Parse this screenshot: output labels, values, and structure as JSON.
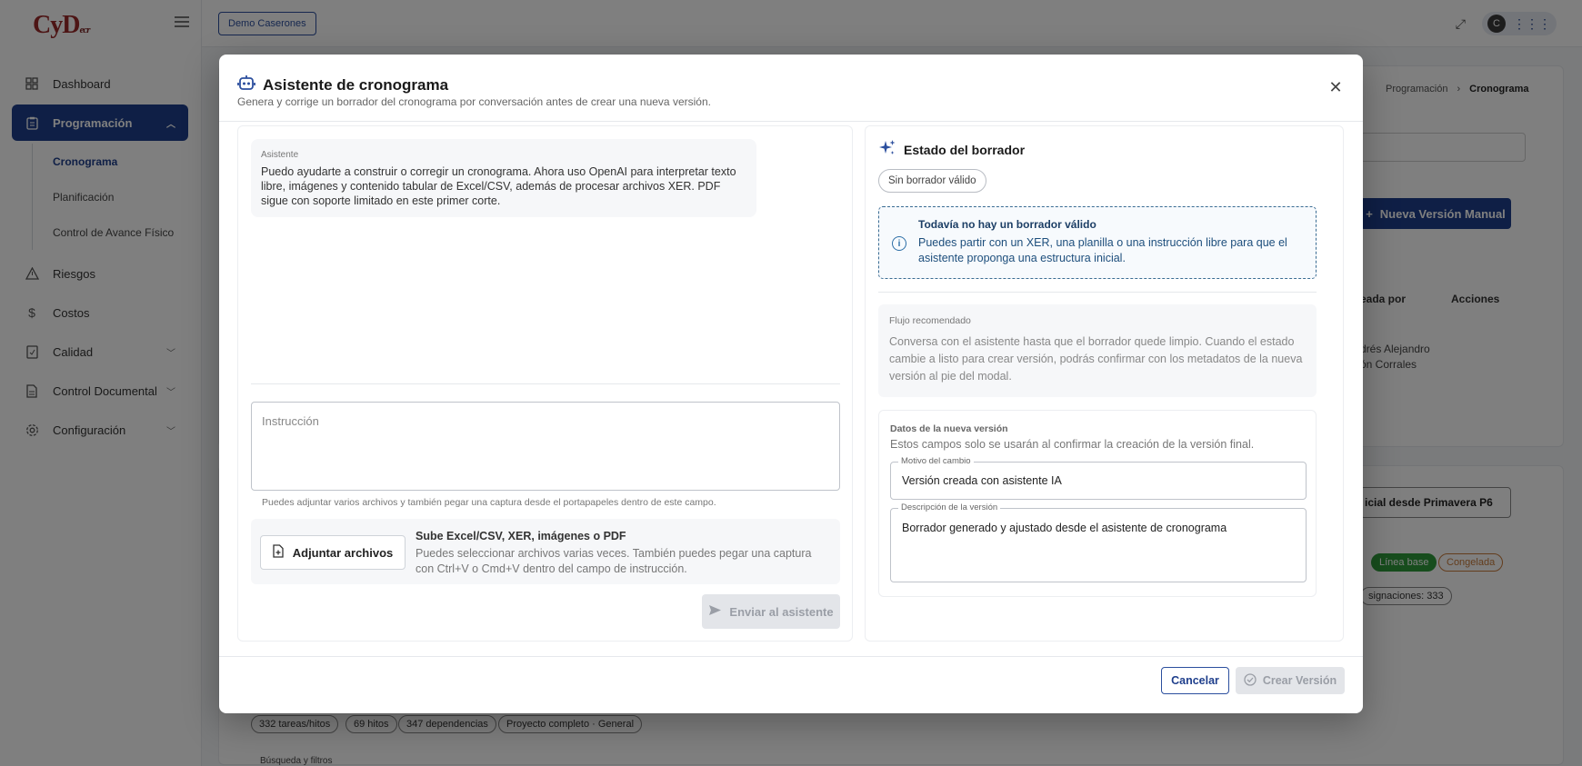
{
  "app": {
    "logo": "CyD",
    "logo_suffix": "ecr",
    "project": "Demo Caserones"
  },
  "sidebar": {
    "items": [
      {
        "label": "Dashboard",
        "icon": "dashboard-icon"
      },
      {
        "label": "Programación",
        "icon": "clipboard-icon",
        "active": true
      },
      {
        "label": "Riesgos",
        "icon": "warning-icon"
      },
      {
        "label": "Costos",
        "icon": "dollar-icon"
      },
      {
        "label": "Calidad",
        "icon": "quality-icon"
      },
      {
        "label": "Control Documental",
        "icon": "document-icon"
      },
      {
        "label": "Configuración",
        "icon": "gear-icon"
      }
    ],
    "subitems": [
      {
        "label": "Cronograma",
        "active": true
      },
      {
        "label": "Planificación"
      },
      {
        "label": "Control de Avance Físico"
      }
    ]
  },
  "topbar": {
    "avatar_letter": "C"
  },
  "background": {
    "breadcrumb": [
      "Programación",
      "Cronograma"
    ],
    "nueva_version": "Nueva Versión Manual",
    "th_creada": "eada por",
    "th_acciones": "Acciones",
    "creator": "drés Alejandro\nón Corrales",
    "import_label": "icial desde Primavera P6",
    "chip_linea": "Línea base",
    "chip_congelada": "Congelada",
    "chip_asignaciones": "signaciones: 333",
    "chip_tareas": "332 tareas/hitos",
    "chip_hitos": "69 hitos",
    "chip_dependencias": "347 dependencias",
    "chip_proyecto": "Proyecto completo · General",
    "busqueda": "Búsqueda y filtros"
  },
  "modal": {
    "title": "Asistente de cronograma",
    "subtitle": "Genera y corrige un borrador del cronograma por conversación antes de crear una nueva versión.",
    "chat": {
      "sender": "Asistente",
      "message": "Puedo ayudarte a construir o corregir un cronograma. Ahora uso OpenAI para interpretar texto libre, imágenes y contenido tabular de Excel/CSV, además de procesar archivos XER. PDF sigue con soporte limitado en este primer corte."
    },
    "instruction_placeholder": "Instrucción",
    "helper_text": "Puedes adjuntar varios archivos y también pegar una captura desde el portapapeles dentro de este campo.",
    "attach": {
      "button": "Adjuntar archivos",
      "title": "Sube Excel/CSV, XER, imágenes o PDF",
      "description": "Puedes seleccionar archivos varias veces. También puedes pegar una captura con Ctrl+V o Cmd+V dentro del campo de instrucción."
    },
    "send_button": "Enviar al asistente",
    "draft": {
      "title": "Estado del borrador",
      "status_chip": "Sin borrador válido",
      "info_title": "Todavía no hay un borrador válido",
      "info_text": "Puedes partir con un XER, una planilla o una instrucción libre para que el asistente proponga una estructura inicial.",
      "flow_label": "Flujo recomendado",
      "flow_text": "Conversa con el asistente hasta que el borrador quede limpio. Cuando el estado cambie a listo para crear versión, podrás confirmar con los metadatos de la nueva versión al pie del modal.",
      "data_label": "Datos de la nueva versión",
      "data_desc": "Estos campos solo se usarán al confirmar la creación de la versión final.",
      "motivo_label": "Motivo del cambio",
      "motivo_value": "Versión creada con asistente IA",
      "descripcion_label": "Descripción de la versión",
      "descripcion_value": "Borrador generado y ajustado desde el asistente de cronograma"
    },
    "cancel_button": "Cancelar",
    "create_button": "Crear Versión"
  },
  "colors": {
    "primary": "#1f3f8c",
    "info_border": "#3a6c93",
    "chip_green": "#2e9a3a"
  }
}
